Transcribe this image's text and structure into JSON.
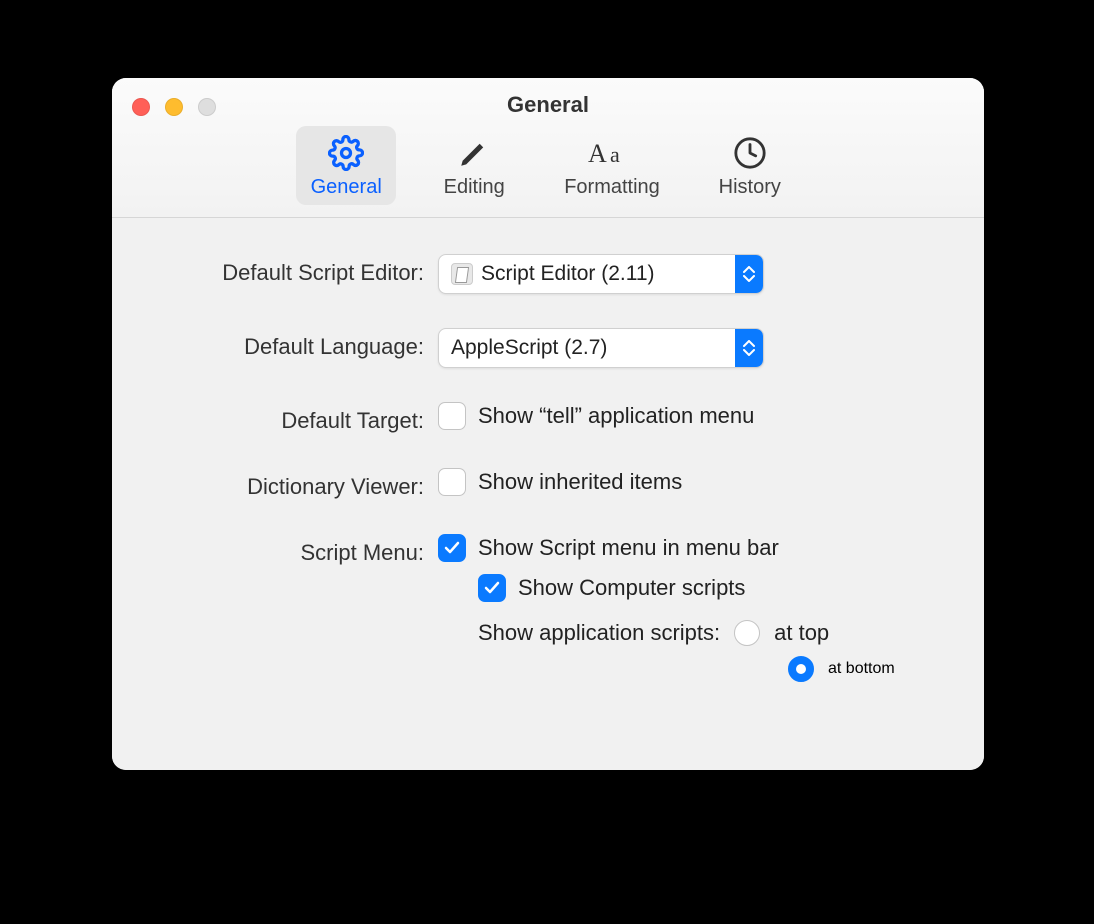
{
  "window": {
    "title": "General"
  },
  "tabs": [
    {
      "label": "General"
    },
    {
      "label": "Editing"
    },
    {
      "label": "Formatting"
    },
    {
      "label": "History"
    }
  ],
  "labels": {
    "default_script_editor": "Default Script Editor:",
    "default_language": "Default Language:",
    "default_target": "Default Target:",
    "dictionary_viewer": "Dictionary Viewer:",
    "script_menu": "Script Menu:"
  },
  "selects": {
    "editor": "Script Editor (2.11)",
    "language": "AppleScript (2.7)"
  },
  "checkboxes": {
    "show_tell": {
      "label": "Show “tell” application menu",
      "checked": false
    },
    "show_inherited": {
      "label": "Show inherited items",
      "checked": false
    },
    "show_script_menu": {
      "label": "Show Script menu in menu bar",
      "checked": true
    },
    "show_computer_scripts": {
      "label": "Show Computer scripts",
      "checked": true
    }
  },
  "radios": {
    "header": "Show application scripts:",
    "at_top": "at top",
    "at_bottom": "at bottom",
    "selected": "at_bottom"
  }
}
